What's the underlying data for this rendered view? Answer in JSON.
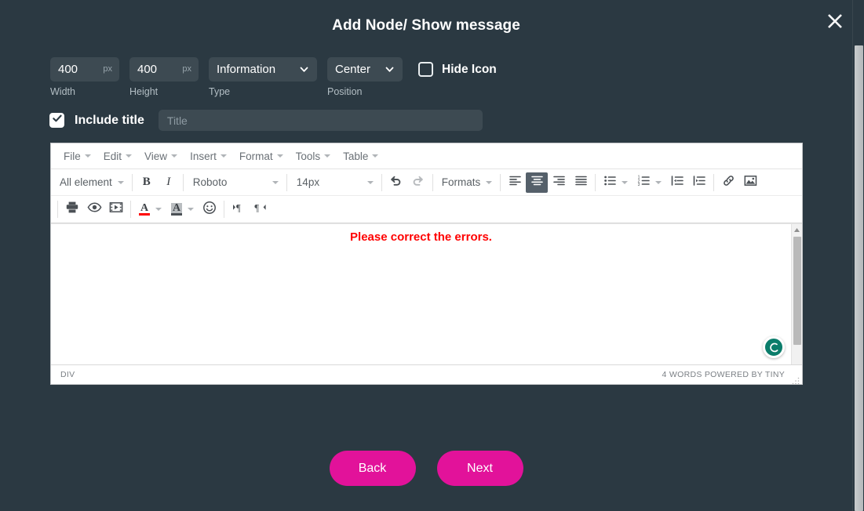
{
  "modal": {
    "title": "Add Node/ Show message",
    "close_icon": "close-icon"
  },
  "controls": {
    "width": {
      "value": "400",
      "unit": "px",
      "label": "Width"
    },
    "height": {
      "value": "400",
      "unit": "px",
      "label": "Height"
    },
    "type": {
      "value": "Information",
      "label": "Type"
    },
    "position": {
      "value": "Center",
      "label": "Position"
    },
    "hide_icon": {
      "label": "Hide Icon",
      "checked": false
    }
  },
  "title_section": {
    "include_title_label": "Include title",
    "include_title_checked": true,
    "title_placeholder": "Title",
    "title_value": ""
  },
  "editor": {
    "menubar": [
      {
        "label": "File"
      },
      {
        "label": "Edit"
      },
      {
        "label": "View"
      },
      {
        "label": "Insert"
      },
      {
        "label": "Format"
      },
      {
        "label": "Tools"
      },
      {
        "label": "Table"
      }
    ],
    "toolbar_row1": {
      "element_select": "All element",
      "bold": "B",
      "italic": "I",
      "font_family": "Roboto",
      "font_size": "14px",
      "undo_icon": "undo-icon",
      "redo_icon": "redo-icon",
      "formats": "Formats",
      "align_left_icon": "align-left-icon",
      "align_center_icon": "align-center-icon",
      "align_right_icon": "align-right-icon",
      "align_justify_icon": "align-justify-icon",
      "bullet_list_icon": "bullet-list-icon",
      "numbered_list_icon": "numbered-list-icon",
      "outdent_icon": "outdent-icon",
      "indent_icon": "indent-icon",
      "link_icon": "link-icon",
      "image_icon": "image-icon",
      "active_alignment": "center"
    },
    "toolbar_row2": {
      "print_icon": "print-icon",
      "preview_icon": "preview-eye-icon",
      "media_icon": "media-film-icon",
      "text_color_icon": "text-color-icon",
      "background_color_icon": "background-color-icon",
      "emoticon_icon": "emoticon-icon",
      "ltr_icon": "paragraph-ltr-icon",
      "rtl_icon": "paragraph-rtl-icon"
    },
    "content": {
      "message": "Please correct the errors."
    },
    "statusbar": {
      "element_path": "DIV",
      "word_count": "4 WORDS POWERED BY TINY"
    },
    "helper_badge_icon": "help-circle-icon"
  },
  "footer": {
    "back_label": "Back",
    "next_label": "Next"
  },
  "colors": {
    "page_background": "#2b3942",
    "field_background": "#3d4a52",
    "accent_button": "#e2129a",
    "error_text": "#ff0000",
    "helper_badge": "#0b7d6b"
  }
}
